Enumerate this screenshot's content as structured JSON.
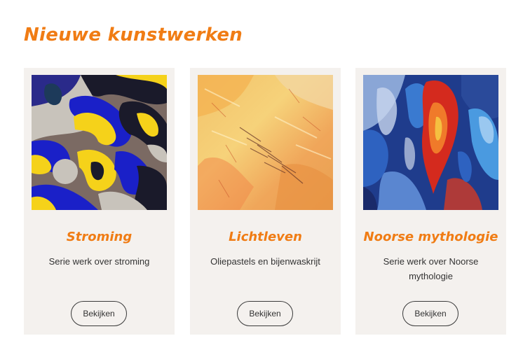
{
  "page": {
    "title": "Nieuwe kunstwerken"
  },
  "colors": {
    "accent": "#f07c14",
    "card_background": "#f4f1ee",
    "text": "#333333",
    "button_border": "#3a3a3a"
  },
  "cards": [
    {
      "title": "Stroming",
      "description": "Serie werk over stroming",
      "button_label": "Bekijken",
      "image": "abstract-painting-flowing-shapes-blue-yellow-brown"
    },
    {
      "title": "Lichtleven",
      "description": "Oliepastels en bijenwaskrijt",
      "button_label": "Bekijken",
      "image": "abstract-painting-orange-yellow-texture"
    },
    {
      "title": "Noorse mythologie",
      "description": "Serie werk over Noorse mythologie",
      "button_label": "Bekijken",
      "image": "abstract-painting-red-flame-blue-waves"
    }
  ]
}
